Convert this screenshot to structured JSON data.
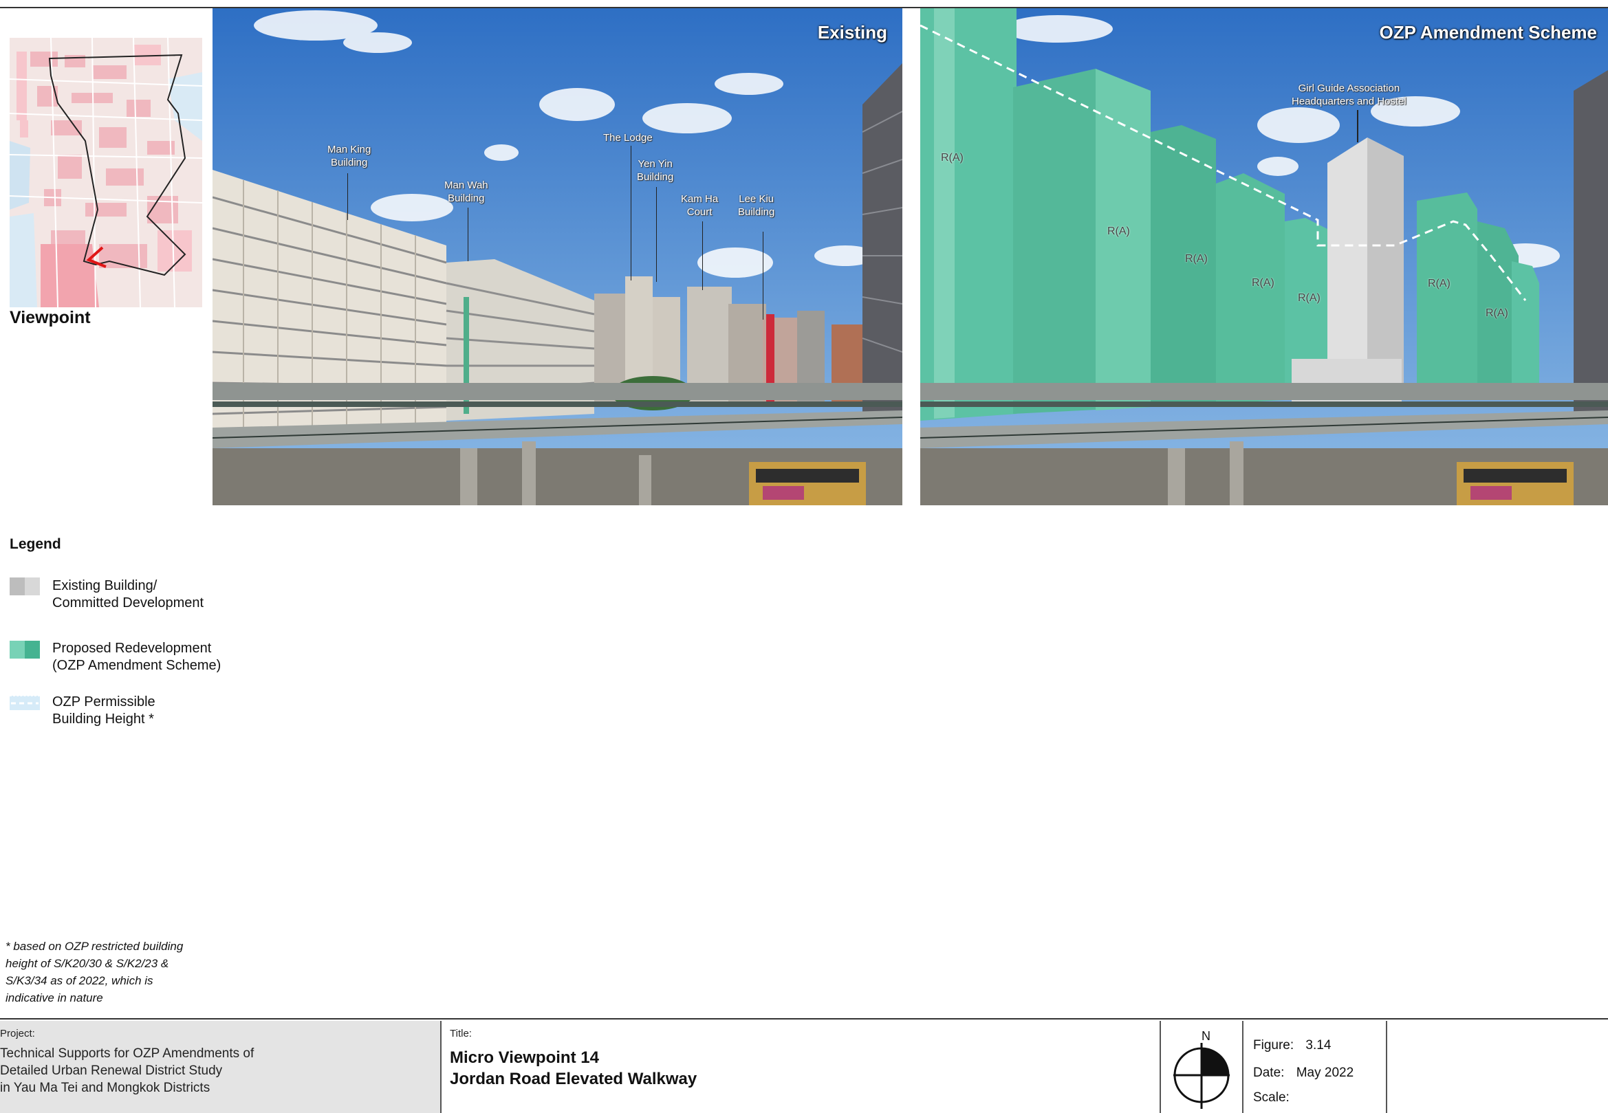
{
  "sidebar": {
    "viewpoint_title": "Viewpoint",
    "legend_title": "Legend",
    "legend": [
      {
        "line1": "Existing Building/",
        "line2": "Committed Development"
      },
      {
        "line1": "Proposed Redevelopment",
        "line2": "(OZP Amendment Scheme)"
      },
      {
        "line1": "OZP Permissible",
        "line2": "Building Height *"
      }
    ],
    "footnote": [
      "* based on OZP restricted building",
      "height of S/K20/30 & S/K2/23 &",
      "S/K3/34 as of 2022, which is",
      "indicative in nature"
    ]
  },
  "colors": {
    "existing": "#c9c9c9",
    "proposed": "#5cc2a4",
    "ozp_line": "#d6ebf8"
  },
  "panels": {
    "existing": {
      "title": "Existing",
      "labels": [
        {
          "name": "man-king",
          "line1": "Man King",
          "line2": "Building"
        },
        {
          "name": "man-wah",
          "line1": "Man Wah",
          "line2": "Building"
        },
        {
          "name": "the-lodge",
          "line1": "The Lodge",
          "line2": ""
        },
        {
          "name": "yen-yin",
          "line1": "Yen Yin",
          "line2": "Building"
        },
        {
          "name": "kam-ha",
          "line1": "Kam Ha",
          "line2": "Court"
        },
        {
          "name": "lee-kiu",
          "line1": "Lee Kiu",
          "line2": "Building"
        }
      ]
    },
    "ozp": {
      "title": "OZP Amendment Scheme",
      "girl_guide": {
        "line1": "Girl Guide Association",
        "line2": "Headquarters and Hostel"
      },
      "ra_label": "R(A)"
    }
  },
  "title_block": {
    "project_caption": "Project:",
    "project_lines": [
      "Technical Supports for OZP Amendments of",
      "Detailed Urban Renewal District Study",
      "in Yau Ma Tei and Mongkok Districts"
    ],
    "title_caption": "Title:",
    "title_line1": "Micro Viewpoint 14",
    "title_line2": "Jordan Road Elevated Walkway",
    "north": "N",
    "figure_label": "Figure:",
    "figure_value": "3.14",
    "date_label": "Date:",
    "date_value": "May 2022",
    "scale_label": "Scale:"
  }
}
